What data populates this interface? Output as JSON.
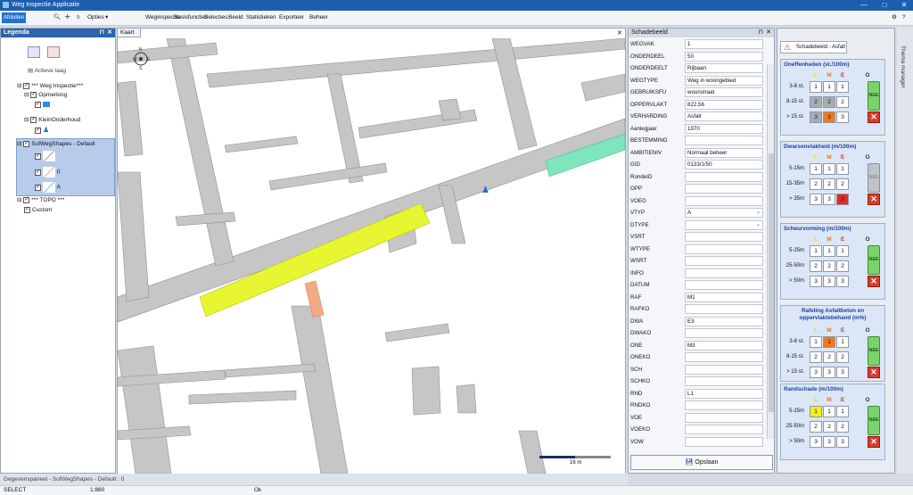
{
  "app": {
    "title": "Weg Inspectie Applicatie"
  },
  "menu": {
    "afsluiten": "Afsluiten",
    "opties": "Opties",
    "items": [
      "Weginspectie",
      "Basisfuncties",
      "Selecties",
      "Beeld",
      "Statistieken",
      "Exporteer",
      "Beheer"
    ]
  },
  "legend": {
    "title": "Legenda",
    "actieve_laag": "Actieve laag",
    "layers": {
      "weg": "*** Weg Inspectie***",
      "opmerking": "Opmerking",
      "klein": "KleinOnderhoud",
      "suf": "SufWegShapes - Default",
      "sub0": "0",
      "subA": "A",
      "topo": "*** TOPO ***",
      "custom": "Custom"
    }
  },
  "map": {
    "tab": "Kaart",
    "scale": "16 m"
  },
  "schadebeeld": {
    "title": "Schadebeeld",
    "fields": [
      {
        "label": "WEGVAK",
        "value": "1"
      },
      {
        "label": "ONDERDEEL",
        "value": "50"
      },
      {
        "label": "ONDERDEELT",
        "value": "Rijbaan"
      },
      {
        "label": "WEGTYPE",
        "value": "Weg in woongebied"
      },
      {
        "label": "GEBRUIKSFU",
        "value": "woonstraat"
      },
      {
        "label": "OPPERVLAKT",
        "value": "822,56"
      },
      {
        "label": "VERHARDING",
        "value": "Asfalt"
      },
      {
        "label": "Aanlegjaar",
        "value": "1970"
      },
      {
        "label": "BESTEMMING",
        "value": ""
      },
      {
        "label": "AMBITIENIV",
        "value": "Normaal beheer"
      },
      {
        "label": "GID",
        "value": "0133/1/50"
      },
      {
        "label": "RondeID",
        "value": ""
      },
      {
        "label": "OPP",
        "value": ""
      },
      {
        "label": "VOEG",
        "value": ""
      },
      {
        "label": "VTYP",
        "value": "A"
      },
      {
        "label": "DTYPE",
        "value": ""
      },
      {
        "label": "VSRT",
        "value": ""
      },
      {
        "label": "WTYPE",
        "value": ""
      },
      {
        "label": "WSRT",
        "value": ""
      },
      {
        "label": "INFO",
        "value": ""
      },
      {
        "label": "DATUM",
        "value": ""
      },
      {
        "label": "RAF",
        "value": "M1"
      },
      {
        "label": "RAFKO",
        "value": ""
      },
      {
        "label": "DWA",
        "value": "E3"
      },
      {
        "label": "DWAKO",
        "value": ""
      },
      {
        "label": "ONE",
        "value": "M3"
      },
      {
        "label": "ONEKO",
        "value": ""
      },
      {
        "label": "SCH",
        "value": ""
      },
      {
        "label": "SCHKO",
        "value": ""
      },
      {
        "label": "RND",
        "value": "L1"
      },
      {
        "label": "RNDKO",
        "value": ""
      },
      {
        "label": "VOE",
        "value": ""
      },
      {
        "label": "VOEKO",
        "value": ""
      },
      {
        "label": "VOW",
        "value": ""
      }
    ],
    "save": "Opslaan"
  },
  "asfalt": {
    "tab": "Schadebeeld - Asfalt",
    "nee": "NEE",
    "nee_gray": "NEE",
    "x": "✕",
    "cols": [
      "L",
      "M",
      "E",
      "O"
    ],
    "cards": [
      {
        "title": "Oneffenheden (st./100m)",
        "rows": [
          "3-8 st.",
          "8-15 st.",
          "> 15 st."
        ],
        "grid": [
          [
            "1",
            "1",
            "1"
          ],
          [
            "2",
            "2",
            "2"
          ],
          [
            "3",
            "3",
            "3"
          ]
        ]
      },
      {
        "title": "Dwarsonvlakheid (m/100m)",
        "rows": [
          "5-15m",
          "15-35m",
          "> 35m"
        ],
        "grid": [
          [
            "1",
            "1",
            "1"
          ],
          [
            "2",
            "2",
            "2"
          ],
          [
            "3",
            "3",
            "3"
          ]
        ]
      },
      {
        "title": "Scheurvorming (m/100m)",
        "rows": [
          "5-25m",
          "25-50m",
          "> 50m"
        ],
        "grid": [
          [
            "1",
            "1",
            "1"
          ],
          [
            "2",
            "2",
            "2"
          ],
          [
            "3",
            "3",
            "3"
          ]
        ]
      },
      {
        "title": "Rafeling Asfaltbeton en oppervlaktebehand (m%)",
        "rows": [
          "3-8 st.",
          "8-15 st.",
          "> 15 st."
        ],
        "grid": [
          [
            "1",
            "1",
            "1"
          ],
          [
            "2",
            "2",
            "2"
          ],
          [
            "3",
            "3",
            "3"
          ]
        ]
      },
      {
        "title": "Randschade (m/100m)",
        "rows": [
          "5-25m",
          "25-50m",
          "> 50m"
        ],
        "grid": [
          [
            "1",
            "1",
            "1"
          ],
          [
            "2",
            "2",
            "2"
          ],
          [
            "3",
            "3",
            "3"
          ]
        ]
      }
    ],
    "highlights": {
      "orange": "#f07a1a",
      "red": "#e8291c",
      "yellow": "#f5f017",
      "gray": "#a9adb3"
    }
  },
  "thema": "Thema manager",
  "panel_bottom": "Gegevenspaneel - SufWegShapes - Default : 0",
  "status": {
    "mode": "SELECT",
    "scale": "1:880",
    "ok": "Ok"
  }
}
